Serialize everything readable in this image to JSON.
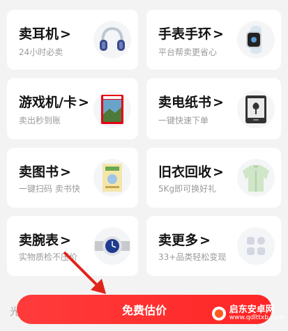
{
  "categories": [
    {
      "title": "卖耳机",
      "subtitle": "24小时必卖",
      "icon": "headphones-icon"
    },
    {
      "title": "手表手环",
      "subtitle": "平台帮卖更省心",
      "icon": "smartwatch-icon"
    },
    {
      "title": "游戏机/卡",
      "subtitle": "卖出秒到账",
      "icon": "game-card-icon"
    },
    {
      "title": "卖电纸书",
      "subtitle": "一键快速下单",
      "icon": "ereader-icon"
    },
    {
      "title": "卖图书",
      "subtitle": "一键扫码 卖书快",
      "icon": "book-icon"
    },
    {
      "title": "旧衣回收",
      "subtitle": "5Kg即可换好礼",
      "icon": "jacket-icon"
    },
    {
      "title": "卖腕表",
      "subtitle": "实物质检不压价",
      "icon": "wristwatch-icon"
    },
    {
      "title": "卖更多",
      "subtitle": "33+品类轻松变现",
      "icon": "more-apps-icon"
    }
  ],
  "chevron": ">",
  "footer": {
    "left_text": "光",
    "cta_label": "免费估价"
  },
  "watermark": {
    "name": "启东安卓网",
    "url": "www.qdlttxb.com"
  },
  "colors": {
    "accent": "#ff2d2d",
    "background": "#f3f3f3"
  }
}
